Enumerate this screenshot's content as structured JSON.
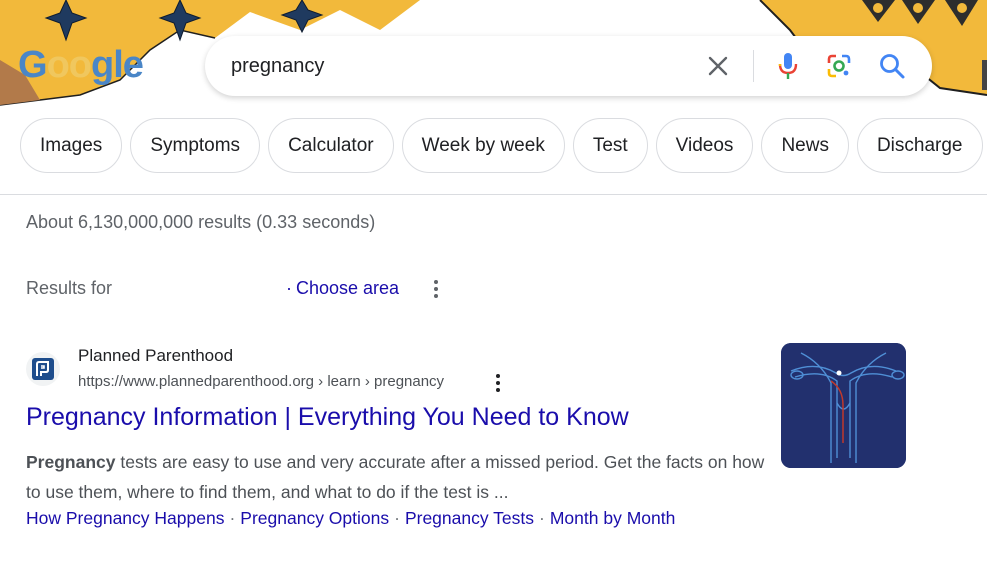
{
  "search": {
    "query": "pregnancy",
    "logo_text": "Google"
  },
  "chips": [
    {
      "label": "Images"
    },
    {
      "label": "Symptoms"
    },
    {
      "label": "Calculator"
    },
    {
      "label": "Week by week"
    },
    {
      "label": "Test"
    },
    {
      "label": "Videos"
    },
    {
      "label": "News"
    },
    {
      "label": "Discharge"
    }
  ],
  "stats": "About 6,130,000,000 results (0.33 seconds)",
  "location": {
    "results_for": "Results for",
    "choose_area": "Choose area"
  },
  "result": {
    "site_name": "Planned Parenthood",
    "url": "https://www.plannedparenthood.org › learn › pregnancy",
    "title": "Pregnancy Information | Everything You Need to Know",
    "snippet_bold": "Pregnancy",
    "snippet_rest": " tests are easy to use and very accurate after a missed period. Get the facts on how to use them, where to find them, and what to do if the test is ...",
    "sitelinks": [
      {
        "label": "How Pregnancy Happens"
      },
      {
        "label": "Pregnancy Options"
      },
      {
        "label": "Pregnancy Tests"
      },
      {
        "label": "Month by Month"
      }
    ]
  },
  "colors": {
    "link": "#1a0dab",
    "doodle_yellow": "#f2b93b",
    "doodle_navy": "#1f3a5f",
    "thumb_bg": "#22306e"
  },
  "icons": [
    "clear-icon",
    "mic-icon",
    "lens-icon",
    "search-icon",
    "more-vert-icon",
    "planned-parenthood-favicon"
  ]
}
